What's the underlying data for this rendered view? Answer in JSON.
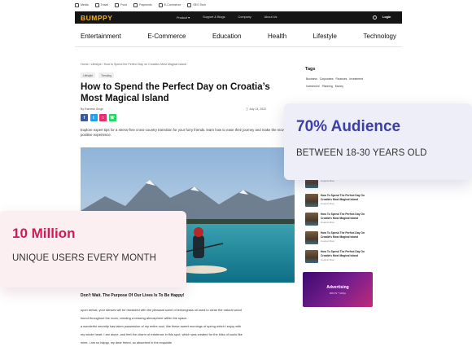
{
  "topbar": {
    "items": [
      "Media",
      "Travel",
      "Food",
      "Payments",
      "E-Commerce",
      "SEO Tech"
    ]
  },
  "nav": {
    "logo": "BUMPPY",
    "links": [
      "Product",
      "Support & Blogs",
      "Company",
      "About Us"
    ],
    "login_label": "Login"
  },
  "categories": [
    "Entertainment",
    "E-Commerce",
    "Education",
    "Health",
    "Lifestyle",
    "Technology"
  ],
  "article": {
    "breadcrumb": "Home /  Lifestyle /  How to Spend the Perfect Day on Croatia's Most Magical Island",
    "chips": [
      "Lifestyle",
      "Trending"
    ],
    "title": "How to Spend the Perfect Day on Croatia’s Most Magical Island",
    "byline": "By Ramesh Singh",
    "date": "July 14, 2022",
    "intro": "Explore expert tips for a stress-free cross-country transition for your furry friends. learn how to ease their journey and make the move a positive experience.",
    "subhead": "Don't Wait. The Purpose Of Our Lives Is To Be Happy!",
    "paragraphs": [
      "upon arrival, your senses will be rewarded with the pleasant scent of lemongrass oil used to clean the natural wood",
      "found throughout the room, creating a relaxing atmosphere within the space.",
      "a wonderful serenity has taken possession of my entire soul, like these sweet mornings of spring which i enjoy with",
      "my whole heart. i am alone, and feel the charm of existence in this spot, which was created for the bliss of souls like",
      "mine. i am so happy, my dear friend, so absorbed in the exquisite"
    ]
  },
  "sidebar": {
    "tags_title": "Tags",
    "tags": [
      "Business",
      "Corporates",
      "Finances",
      "Investment",
      "Investment",
      "Planning",
      "Money"
    ],
    "recent": [
      {
        "title": "Croatia's Most Magical Island",
        "meta": "Gujarat Maa"
      },
      {
        "title": "How To Spend The Perfect Day On Croatia's Most Magical Island",
        "meta": "Gujarat Maa"
      },
      {
        "title": "How To Spend The Perfect Day On Croatia's Most Magical Island",
        "meta": "Gujarat Maa"
      },
      {
        "title": "How To Spend The Perfect Day On Croatia's Most Magical Island",
        "meta": "Gujarat Maa"
      },
      {
        "title": "How To Spend The Perfect Day On Croatia's Most Magical Island",
        "meta": "Gujarat Maa"
      }
    ],
    "ad_title": "Advertising",
    "ad_size": "300 Px * 110px"
  },
  "stats": {
    "audience_value": "70% Audience",
    "audience_desc": "BETWEEN 18-30 YEARS OLD",
    "users_value": "10 Million",
    "users_desc": "UNIQUE USERS EVERY MONTH"
  },
  "colors": {
    "brand": "#f0b429",
    "audience_accent": "#3c3fa6",
    "users_accent": "#d21a5a"
  }
}
